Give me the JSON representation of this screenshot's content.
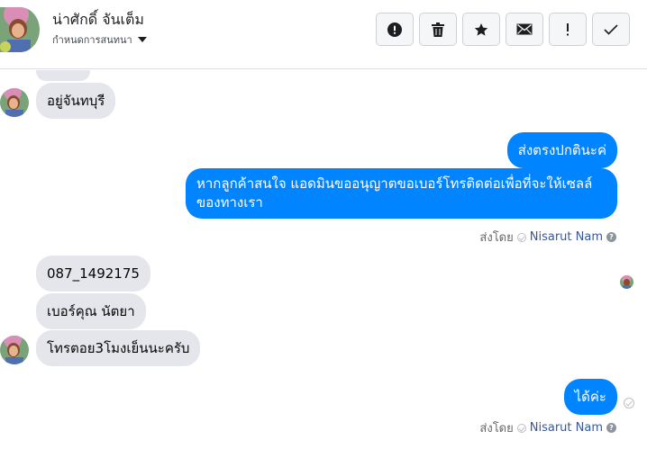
{
  "header": {
    "contact_name": "น่าศักดิ์ จันเต็ม",
    "subtitle": "กำหนดการสนทนา"
  },
  "toolbar": [
    {
      "name": "mark-spam-button",
      "icon": "exclamation-circle-icon"
    },
    {
      "name": "delete-button",
      "icon": "trash-icon"
    },
    {
      "name": "star-button",
      "icon": "star-icon"
    },
    {
      "name": "mark-unread-button",
      "icon": "envelope-icon"
    },
    {
      "name": "follow-up-button",
      "icon": "exclamation-icon"
    },
    {
      "name": "mark-done-button",
      "icon": "checkmark-icon"
    }
  ],
  "messages": {
    "incoming_1": "อยู่จันทบุรี",
    "outgoing_1": "ส่งตรงปกตินะค่",
    "outgoing_2": "หากลูกค้าสนใจ แอดมินขออนุญาตขอเบอร์โทรติดต่อเพื่อที่จะให้เซลล์ของทางเรา",
    "incoming_2": "087_1492175",
    "incoming_3": "เบอร์คุณ นัตยา",
    "incoming_4": "โทรตอย3โมงเย็นนะครับ",
    "outgoing_3": "ได้ค่ะ"
  },
  "sent_by": {
    "label": "ส่งโดย",
    "name": "Nisarut Nam",
    "help": "?"
  },
  "colors": {
    "outgoing_bubble": "#0084ff",
    "incoming_bubble": "#e4e6eb"
  }
}
